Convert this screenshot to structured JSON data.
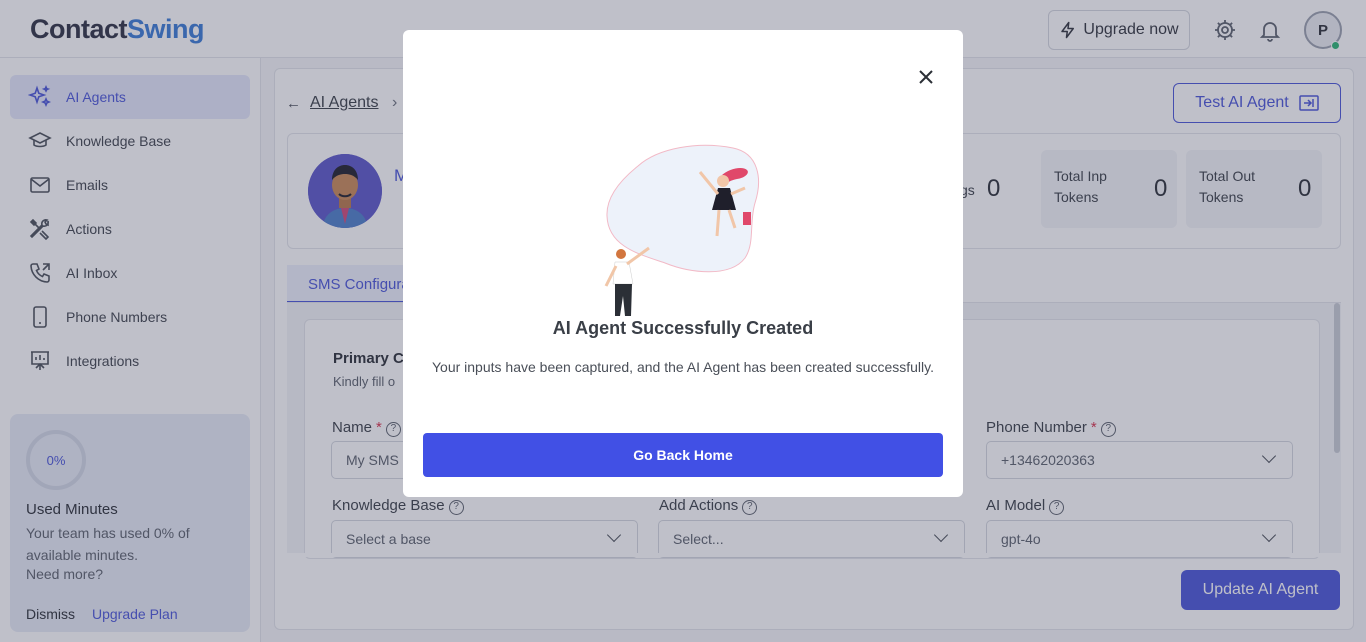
{
  "header": {
    "logo_part1": "Contact",
    "logo_part2": "Swing",
    "upgrade_label": "Upgrade now",
    "avatar_initial": "P"
  },
  "sidebar": {
    "items": [
      {
        "label": "AI Agents",
        "icon": "sparkles-icon",
        "active": true
      },
      {
        "label": "Knowledge Base",
        "icon": "graduation-cap-icon"
      },
      {
        "label": "Emails",
        "icon": "envelope-icon"
      },
      {
        "label": "Actions",
        "icon": "tools-icon"
      },
      {
        "label": "AI Inbox",
        "icon": "phone-incoming-icon"
      },
      {
        "label": "Phone Numbers",
        "icon": "mobile-phone-icon"
      },
      {
        "label": "Integrations",
        "icon": "presentation-board-icon"
      }
    ],
    "usage": {
      "percent_label": "0%",
      "title": "Used Minutes",
      "description": "Your team has used 0% of available minutes.",
      "more": "Need more?",
      "dismiss": "Dismiss",
      "upgrade": "Upgrade Plan"
    }
  },
  "main": {
    "breadcrumb_link": "AI Agents",
    "test_button": "Test AI Agent",
    "agent_name_initial": "M",
    "stats": [
      {
        "label_line1": "Total Inp",
        "label_line2": "Tokens",
        "value": "0"
      },
      {
        "label_line1": "Total Out",
        "label_line2": "Tokens",
        "value": "0"
      }
    ],
    "partial_stat_label": "gs",
    "partial_stat_value": "0",
    "tab_label": "SMS Configura",
    "section_title": "Primary C",
    "section_sub": "Kindly fill o",
    "fields": {
      "name_label": "Name",
      "name_value": "My SMS",
      "phone_label": "Phone Number",
      "phone_value": "+13462020363",
      "kb_label": "Knowledge Base",
      "kb_placeholder": "Select a base",
      "actions_label": "Add Actions",
      "actions_placeholder": "Select...",
      "model_label": "AI Model",
      "model_value": "gpt-4o"
    },
    "update_button": "Update AI Agent"
  },
  "modal": {
    "title": "AI Agent Successfully Created",
    "text": "Your inputs have been captured, and the AI Agent has been created successfully.",
    "button": "Go Back Home"
  },
  "colors": {
    "accent": "#4a55d9",
    "modal_button": "#4150e5",
    "overlay": "rgba(60,63,90,0.33)"
  }
}
